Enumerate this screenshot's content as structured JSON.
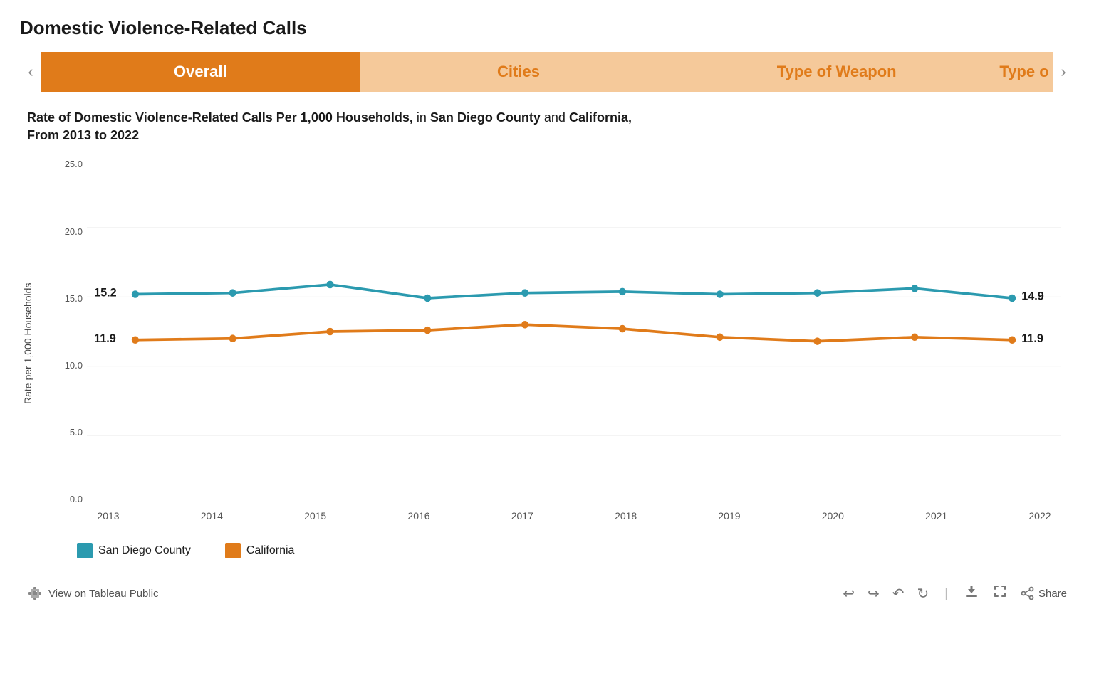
{
  "page": {
    "title": "Domestic Violence-Related Calls"
  },
  "tabs": [
    {
      "label": "Overall",
      "active": true
    },
    {
      "label": "Cities",
      "active": false
    },
    {
      "label": "Type of Weapon",
      "active": false
    },
    {
      "label": "Type o",
      "active": false,
      "partial": true
    }
  ],
  "chart": {
    "title_part1": "Rate of Domestic Violence-Related Calls Per 1,000 Households,",
    "title_part2": " in ",
    "title_san_diego": "San Diego County",
    "title_and": " and ",
    "title_california": "California,",
    "title_part3": " From 2013 to 2022",
    "y_axis_label": "Rate per 1,000 Households",
    "y_ticks": [
      {
        "value": 25.0,
        "label": "25.0"
      },
      {
        "value": 20.0,
        "label": "20.0"
      },
      {
        "value": 15.0,
        "label": "15.0"
      },
      {
        "value": 10.0,
        "label": "10.0"
      },
      {
        "value": 5.0,
        "label": "5.0"
      },
      {
        "value": 0.0,
        "label": "0.0"
      }
    ],
    "x_ticks": [
      "2013",
      "2014",
      "2015",
      "2016",
      "2017",
      "2018",
      "2019",
      "2020",
      "2021",
      "2022"
    ],
    "series": {
      "san_diego": {
        "color": "#2b9aaf",
        "label": "San Diego County",
        "end_value": "14.9",
        "start_value": "15.2",
        "data": [
          15.2,
          15.3,
          15.9,
          14.9,
          15.3,
          15.4,
          15.2,
          15.3,
          15.6,
          14.9
        ]
      },
      "california": {
        "color": "#e07b1a",
        "label": "California",
        "end_value": "11.9",
        "start_value": "11.9",
        "data": [
          11.9,
          12.0,
          12.5,
          12.6,
          13.0,
          12.7,
          12.1,
          11.8,
          12.1,
          11.9
        ]
      }
    }
  },
  "bottom": {
    "tableau_link": "View on Tableau Public",
    "share_label": "Share"
  }
}
